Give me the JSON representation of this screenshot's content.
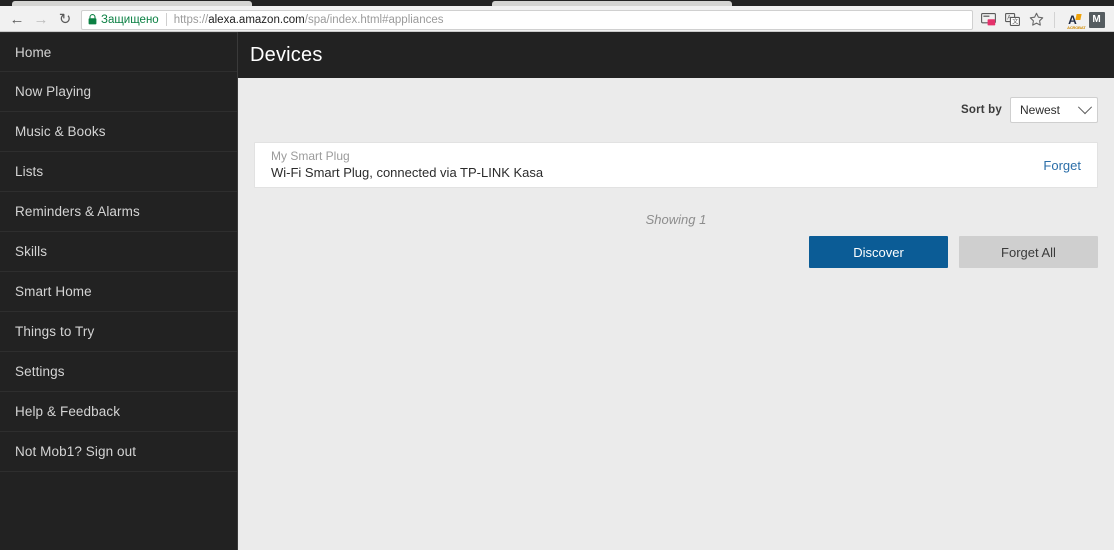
{
  "browser": {
    "back_icon": "back-arrow-icon",
    "forward_icon": "forward-arrow-icon",
    "reload_icon": "reload-icon",
    "back_glyph": "←",
    "forward_glyph": "→",
    "reload_glyph": "↻",
    "security_label": "Защищено",
    "url_scheme": "https://",
    "url_domain": "alexa.amazon.com",
    "url_path": "/spa/index.html#appliances",
    "toolbar_icons": [
      {
        "name": "save-to-pocket-icon",
        "glyph": "⧉"
      },
      {
        "name": "translate-icon",
        "glyph": "❐"
      },
      {
        "name": "bookmark-star-icon",
        "glyph": "☆"
      }
    ],
    "extensions": [
      {
        "name": "adobe-acrobat-extension-icon",
        "letter": "A",
        "sub": "ACROBAT"
      },
      {
        "name": "mail-extension-icon",
        "letter": "M"
      }
    ]
  },
  "sidebar": {
    "items": [
      {
        "label": "Home",
        "key": "home"
      },
      {
        "label": "Now Playing",
        "key": "now-playing"
      },
      {
        "label": "Music & Books",
        "key": "music-books"
      },
      {
        "label": "Lists",
        "key": "lists"
      },
      {
        "label": "Reminders & Alarms",
        "key": "reminders-alarms"
      },
      {
        "label": "Skills",
        "key": "skills"
      },
      {
        "label": "Smart Home",
        "key": "smart-home"
      },
      {
        "label": "Things to Try",
        "key": "things-to-try"
      },
      {
        "label": "Settings",
        "key": "settings"
      },
      {
        "label": "Help & Feedback",
        "key": "help-feedback"
      },
      {
        "label": "Not Mob1? Sign out",
        "key": "sign-out"
      }
    ]
  },
  "header": {
    "title": "Devices"
  },
  "sort": {
    "label": "Sort by",
    "value": "Newest",
    "options": [
      "Newest"
    ]
  },
  "devices": [
    {
      "name": "My Smart Plug",
      "description": "Wi-Fi Smart Plug, connected via TP-LINK Kasa",
      "action_label": "Forget"
    }
  ],
  "status": {
    "showing": "Showing 1"
  },
  "actions": {
    "discover_label": "Discover",
    "forget_all_label": "Forget All"
  },
  "colors": {
    "sidebar_bg": "#222222",
    "header_bg": "#222222",
    "content_bg": "#ebebeb",
    "primary_button": "#0b5c96",
    "secondary_button": "#cfcfcf",
    "link": "#2b6ea8",
    "secure_green": "#0b8043"
  }
}
